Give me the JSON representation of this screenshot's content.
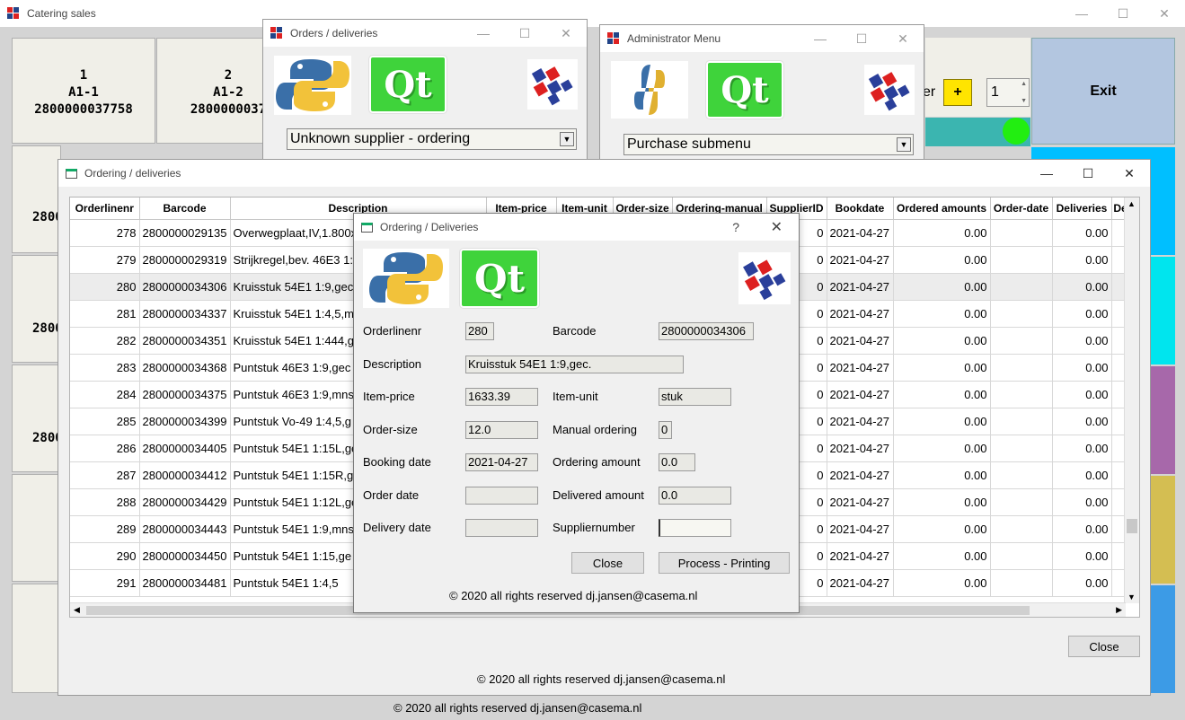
{
  "main": {
    "title": "Catering sales",
    "tiles": [
      {
        "line1": "1",
        "line2": "A1-1",
        "line3": "2800000037758"
      },
      {
        "line1": "2",
        "line2": "A1-2",
        "line3": "2800000037"
      }
    ],
    "left_partial": [
      "2800",
      "2800",
      "2800"
    ],
    "spin_value": "1",
    "plus_label": "+",
    "er_label": "er",
    "exit_label": "Exit",
    "footer": "© 2020 all rights reserved dj.jansen@casema.nl",
    "colors": {
      "exit": "#b3c6e0",
      "cyan1": "#00bfff",
      "cyan2": "#00e5ee",
      "purple": "#a768aa",
      "gold": "#d4be52",
      "blue": "#3c9be6",
      "green_dot": "#22ee11"
    }
  },
  "orders_win": {
    "title": "Orders / deliveries",
    "combo": "Unknown supplier - ordering"
  },
  "admin_win": {
    "title": "Administrator Menu",
    "combo": "Purchase submenu"
  },
  "ordering_win": {
    "title": "Ordering / deliveries",
    "close_label": "Close",
    "footer": "© 2020 all rights reserved dj.jansen@casema.nl",
    "columns": [
      "Orderlinenr",
      "Barcode",
      "Description",
      "Item-price",
      "Item-unit",
      "Order-size",
      "Ordering-manual",
      "SupplierID",
      "Bookdate",
      "Ordered amounts",
      "Order-date",
      "Deliveries",
      "De"
    ],
    "rows": [
      {
        "nr": "278",
        "barcode": "2800000029135",
        "desc": "Overwegplaat,IV,1.800x",
        "sid": "0",
        "bookdate": "2021-04-27",
        "ordered": "0.00",
        "deliveries": "0.00"
      },
      {
        "nr": "279",
        "barcode": "2800000029319",
        "desc": "Strijkregel,bev. 46E3 1:",
        "sid": "0",
        "bookdate": "2021-04-27",
        "ordered": "0.00",
        "deliveries": "0.00"
      },
      {
        "nr": "280",
        "barcode": "2800000034306",
        "desc": "Kruisstuk 54E1 1:9,gec",
        "sid": "0",
        "bookdate": "2021-04-27",
        "ordered": "0.00",
        "deliveries": "0.00"
      },
      {
        "nr": "281",
        "barcode": "2800000034337",
        "desc": "Kruisstuk 54E1 1:4,5,m",
        "sid": "0",
        "bookdate": "2021-04-27",
        "ordered": "0.00",
        "deliveries": "0.00"
      },
      {
        "nr": "282",
        "barcode": "2800000034351",
        "desc": "Kruisstuk 54E1 1:444,g",
        "sid": "0",
        "bookdate": "2021-04-27",
        "ordered": "0.00",
        "deliveries": "0.00"
      },
      {
        "nr": "283",
        "barcode": "2800000034368",
        "desc": "Puntstuk 46E3 1:9,gec",
        "sid": "0",
        "bookdate": "2021-04-27",
        "ordered": "0.00",
        "deliveries": "0.00"
      },
      {
        "nr": "284",
        "barcode": "2800000034375",
        "desc": "Puntstuk 46E3 1:9,mns",
        "sid": "0",
        "bookdate": "2021-04-27",
        "ordered": "0.00",
        "deliveries": "0.00"
      },
      {
        "nr": "285",
        "barcode": "2800000034399",
        "desc": "Puntstuk Vo-49 1:4,5,g",
        "sid": "0",
        "bookdate": "2021-04-27",
        "ordered": "0.00",
        "deliveries": "0.00"
      },
      {
        "nr": "286",
        "barcode": "2800000034405",
        "desc": "Puntstuk 54E1 1:15L,ge",
        "sid": "0",
        "bookdate": "2021-04-27",
        "ordered": "0.00",
        "deliveries": "0.00"
      },
      {
        "nr": "287",
        "barcode": "2800000034412",
        "desc": "Puntstuk 54E1 1:15R,g",
        "sid": "0",
        "bookdate": "2021-04-27",
        "ordered": "0.00",
        "deliveries": "0.00"
      },
      {
        "nr": "288",
        "barcode": "2800000034429",
        "desc": "Puntstuk 54E1 1:12L,ge",
        "sid": "0",
        "bookdate": "2021-04-27",
        "ordered": "0.00",
        "deliveries": "0.00"
      },
      {
        "nr": "289",
        "barcode": "2800000034443",
        "desc": "Puntstuk 54E1 1:9,mns",
        "sid": "0",
        "bookdate": "2021-04-27",
        "ordered": "0.00",
        "deliveries": "0.00"
      },
      {
        "nr": "290",
        "barcode": "2800000034450",
        "desc": "Puntstuk 54E1 1:15,ge",
        "sid": "0",
        "bookdate": "2021-04-27",
        "ordered": "0.00",
        "deliveries": "0.00"
      },
      {
        "nr": "291",
        "barcode": "2800000034481",
        "desc": "Puntstuk 54E1 1:4,5",
        "sid": "0",
        "bookdate": "2021-04-27",
        "ordered": "0.00",
        "deliveries": "0.00"
      }
    ]
  },
  "dialog": {
    "title": "Ordering / Deliveries",
    "help": "?",
    "labels": {
      "orderlinenr": "Orderlinenr",
      "barcode": "Barcode",
      "description": "Description",
      "item_price": "Item-price",
      "item_unit": "Item-unit",
      "order_size": "Order-size",
      "manual_ordering": "Manual ordering",
      "booking_date": "Booking date",
      "ordering_amount": "Ordering amount",
      "order_date": "Order date",
      "delivered_amount": "Delivered amount",
      "delivery_date": "Delivery date",
      "suppliernumber": "Suppliernumber"
    },
    "values": {
      "orderlinenr": "280",
      "barcode": "2800000034306",
      "description": "Kruisstuk 54E1 1:9,gec.",
      "item_price": "1633.39",
      "item_unit": "stuk",
      "order_size": "12.0",
      "manual_ordering": "0",
      "booking_date": "2021-04-27",
      "ordering_amount": "0.0",
      "order_date": "",
      "delivered_amount": "0.0",
      "delivery_date": "",
      "suppliernumber": ""
    },
    "close_label": "Close",
    "process_label": "Process - Printing",
    "footer": "© 2020 all rights reserved dj.jansen@casema.nl"
  }
}
